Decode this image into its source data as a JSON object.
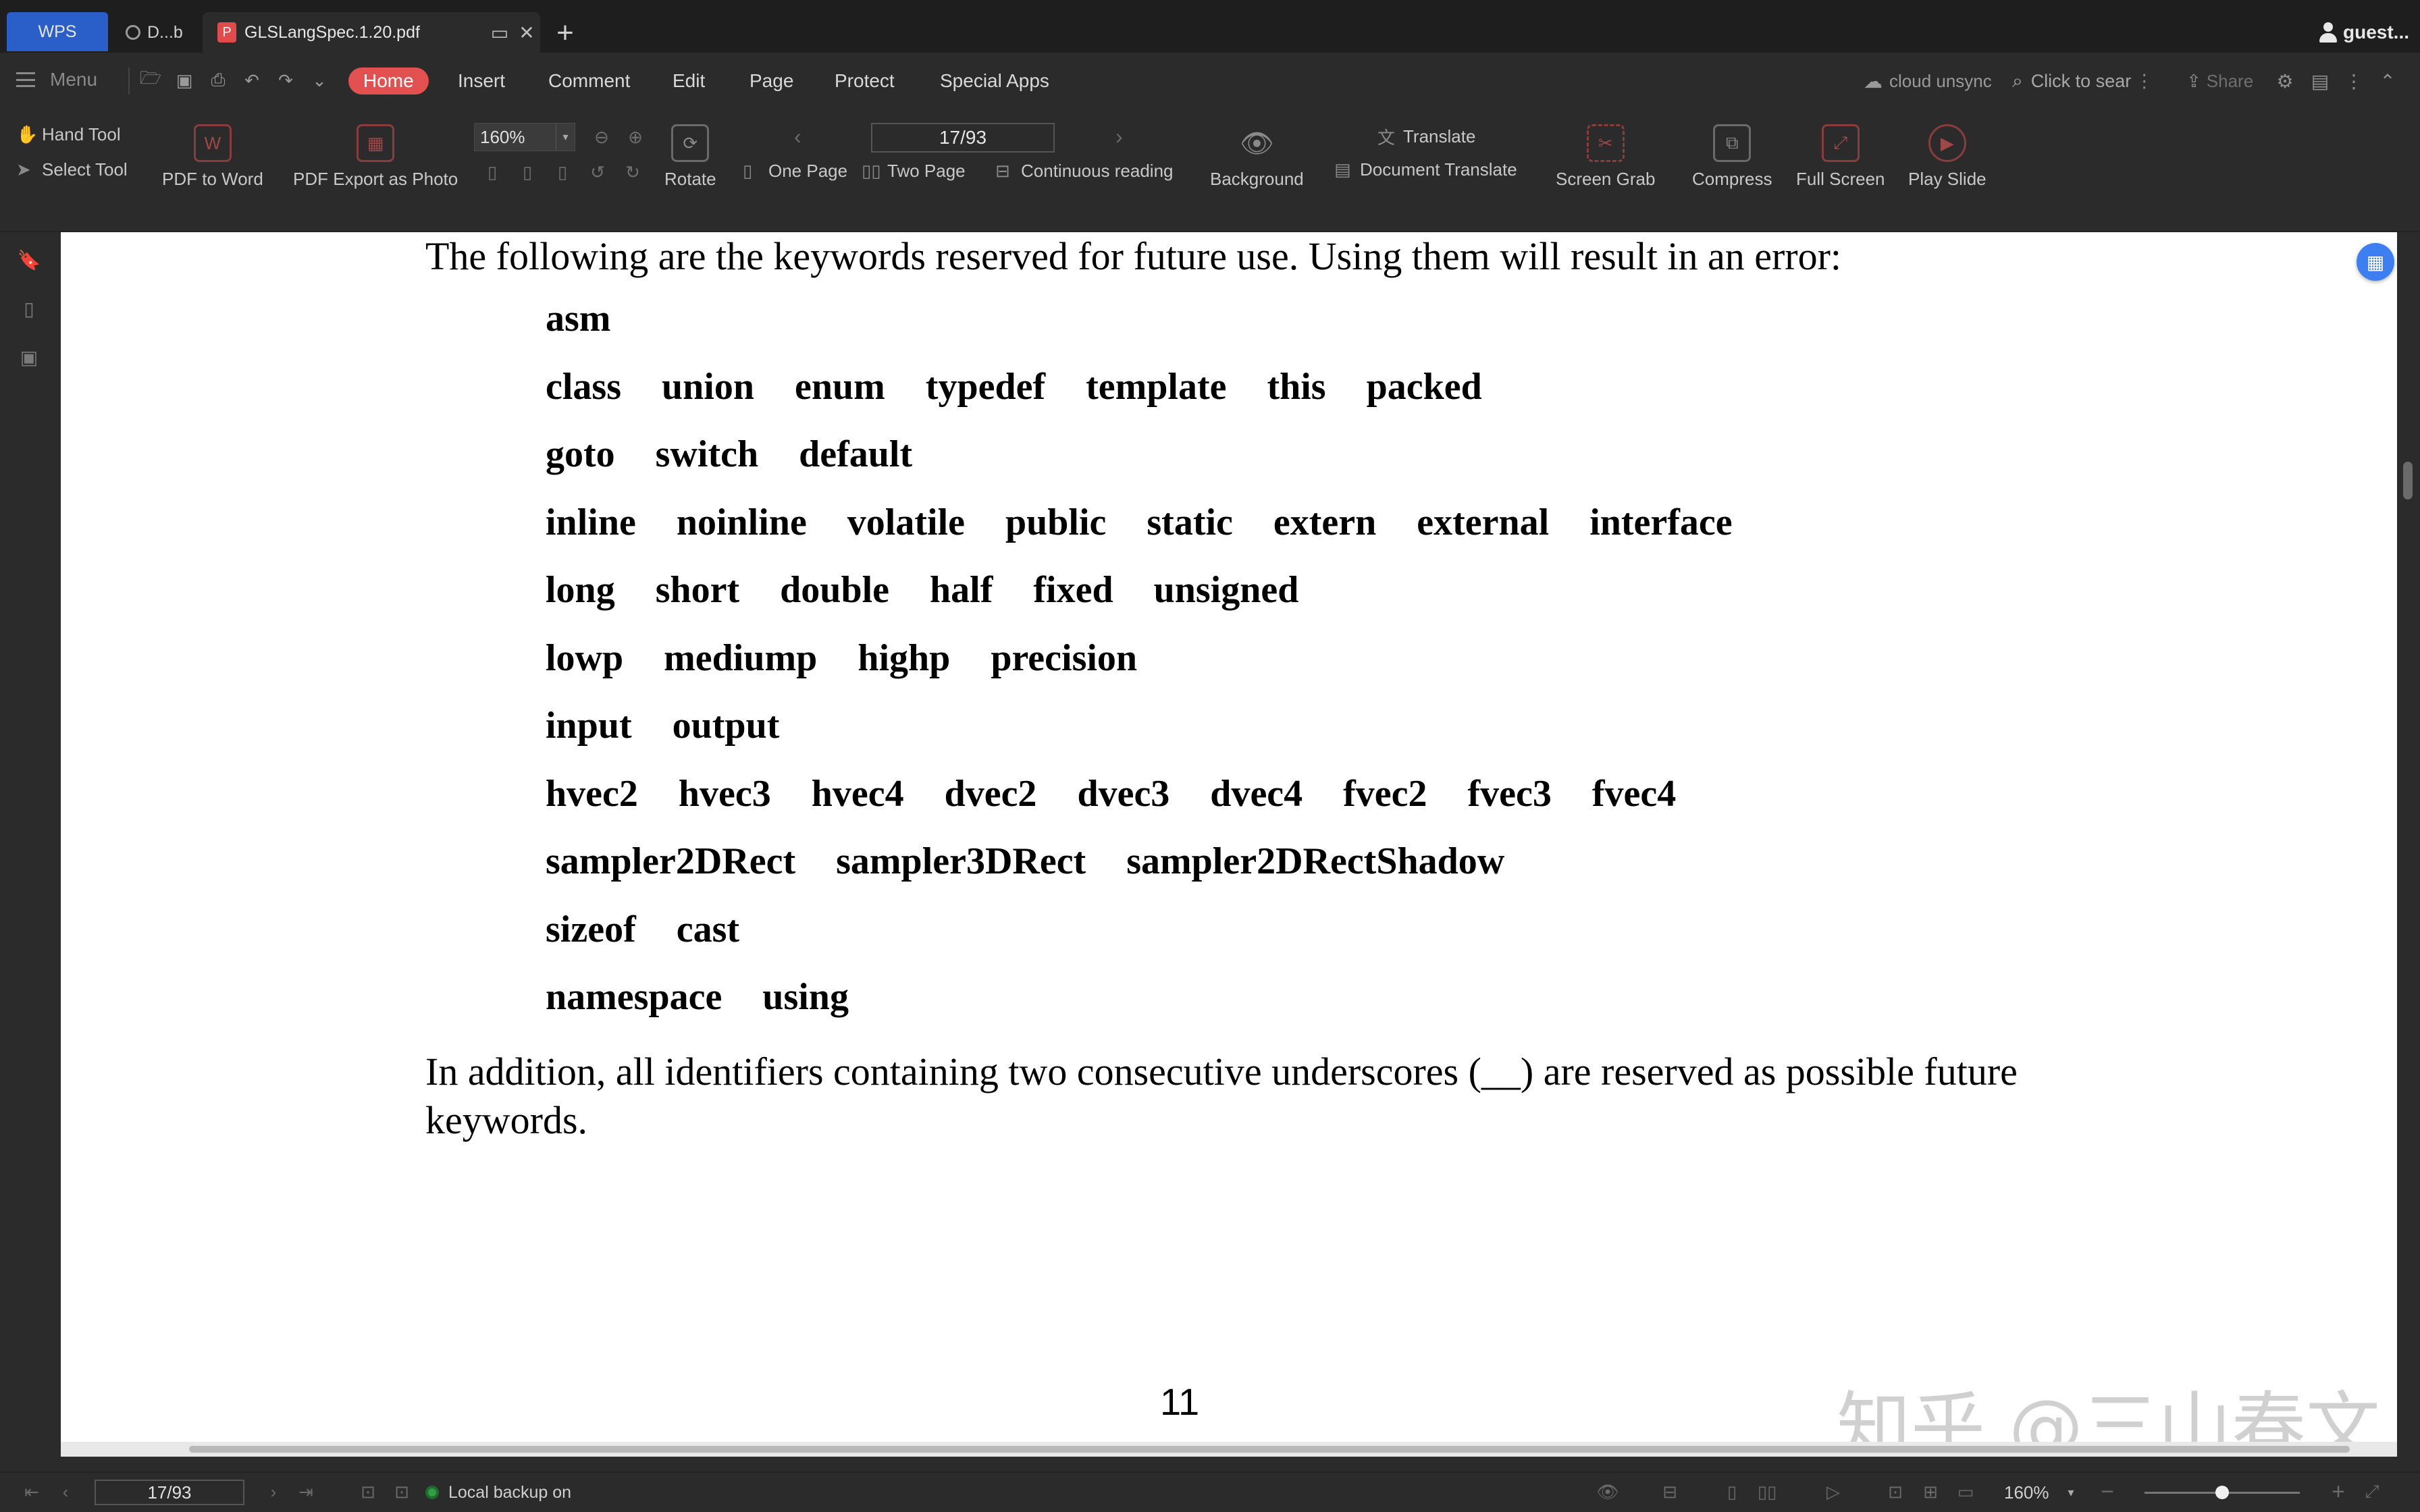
{
  "tabs": {
    "wps": "WPS",
    "doc": "D...b",
    "pdf": "GLSLangSpec.1.20.pdf",
    "user": "guest..."
  },
  "menubar": {
    "menu": "Menu",
    "tabs": [
      "Home",
      "Insert",
      "Comment",
      "Edit",
      "Page",
      "Protect",
      "Special Apps"
    ],
    "cloud": "cloud unsync",
    "search": "Click to sear",
    "share": "Share"
  },
  "ribbon": {
    "hand_tool": "Hand Tool",
    "select_tool": "Select Tool",
    "pdf_to_word": "PDF to Word",
    "pdf_export_photo": "PDF Export as Photo",
    "zoom": "160%",
    "rotate": "Rotate",
    "page_indicator": "17/93",
    "one_page": "One Page",
    "two_page": "Two Page",
    "continuous": "Continuous reading",
    "background": "Background",
    "translate": "Translate",
    "document_translate": "Document Translate",
    "screen_grab": "Screen Grab",
    "compress": "Compress",
    "full_screen": "Full Screen",
    "play_slide": "Play Slide"
  },
  "document": {
    "intro": "The following are the keywords reserved for future use.  Using them will result in an error:",
    "keyword_rows": [
      [
        "asm"
      ],
      [
        "class",
        "union",
        "enum",
        "typedef",
        "template",
        "this",
        "packed"
      ],
      [
        "goto",
        "switch",
        "default"
      ],
      [
        "inline",
        "noinline",
        "volatile",
        "public",
        "static",
        "extern",
        "external",
        "interface"
      ],
      [
        "long",
        "short",
        "double",
        "half",
        "fixed",
        "unsigned"
      ],
      [
        "lowp",
        "mediump",
        "highp",
        "precision"
      ],
      [
        "input",
        "output"
      ],
      [
        "hvec2",
        "hvec3",
        "hvec4",
        "dvec2",
        "dvec3",
        "dvec4",
        "fvec2",
        "fvec3",
        "fvec4"
      ],
      [
        "sampler2DRect",
        "sampler3DRect",
        "sampler2DRectShadow"
      ],
      [
        "sizeof",
        "cast"
      ],
      [
        "namespace",
        "using"
      ]
    ],
    "outro": "In addition, all identifiers containing two consecutive underscores (__) are reserved as possible future keywords.",
    "page_number": "11",
    "watermark": "知乎 @三山春文"
  },
  "statusbar": {
    "page": "17/93",
    "backup": "Local backup on",
    "zoom": "160%"
  },
  "colors": {
    "home_tab": "#e35050",
    "wps_tab": "#2a5fc9",
    "backup_dot": "#2f9e44",
    "float_button": "#3d7ff0"
  },
  "zoom_level_fraction": 0.5
}
